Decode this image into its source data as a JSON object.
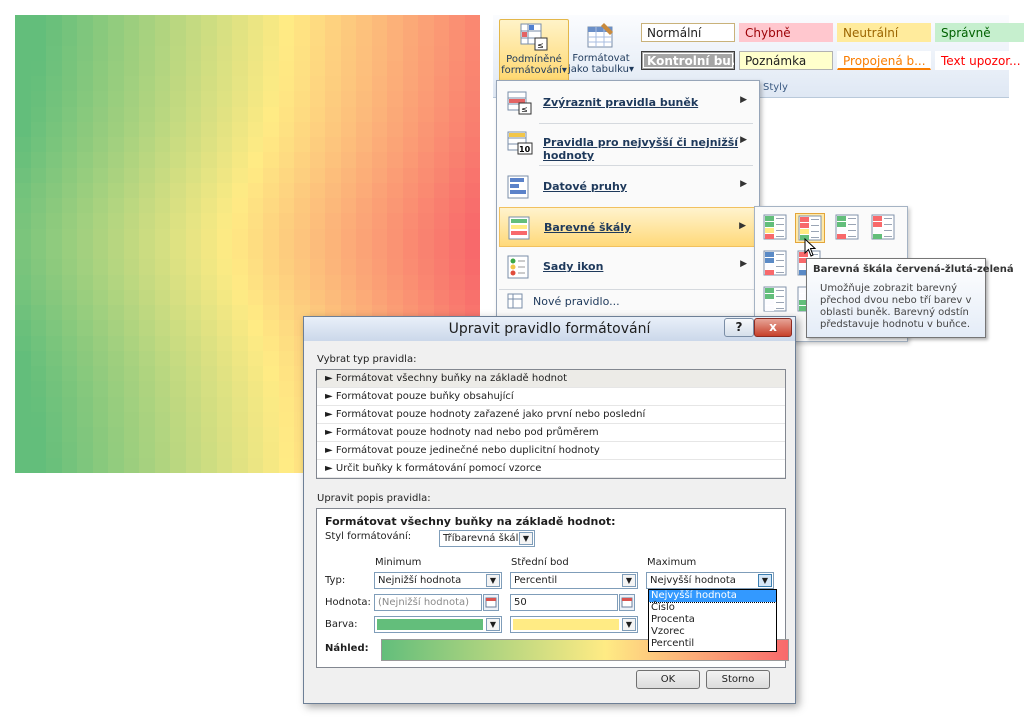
{
  "ribbon": {
    "cond_format": {
      "line1": "Podmíněné",
      "line2": "formátování",
      "arrow": "▾"
    },
    "format_table": {
      "line1": "Formátovat",
      "line2": "jako tabulku",
      "arrow": "▾"
    },
    "styles": [
      {
        "label": "Normální",
        "bg": "#ffffff",
        "fg": "#1e1e1e",
        "border": "#c9b27a"
      },
      {
        "label": "Chybně",
        "bg": "#ffc7ce",
        "fg": "#9c0006",
        "border": "#ffc7ce"
      },
      {
        "label": "Neutrální",
        "bg": "#ffeb9c",
        "fg": "#9c6500",
        "border": "#ffeb9c"
      },
      {
        "label": "Správně",
        "bg": "#c6efce",
        "fg": "#006100",
        "border": "#c6efce"
      },
      {
        "label": "Kontrolní bu...",
        "bg": "#a5a5a5",
        "fg": "#ffffff",
        "border": "#3f3f3f"
      },
      {
        "label": "Poznámka",
        "bg": "#ffffcc",
        "fg": "#1e1e1e",
        "border": "#b2b2b2"
      },
      {
        "label": "Propojená b...",
        "bg": "#ffffff",
        "fg": "#fa7d00",
        "border": "#ffffff"
      },
      {
        "label": "Text upozor...",
        "bg": "#ffffff",
        "fg": "#ff0000",
        "border": "#ffffff"
      }
    ],
    "group_label": "Styly"
  },
  "menu": {
    "items": [
      {
        "label": "Zvýraznit pravidla buněk",
        "icon": "highlight-rules-icon"
      },
      {
        "label": "Pravidla pro nejvyšší či nejnižší hodnoty",
        "icon": "top-bottom-icon"
      },
      {
        "label": "Datové pruhy",
        "icon": "data-bars-icon"
      },
      {
        "label": "Barevné škály",
        "icon": "color-scales-icon"
      },
      {
        "label": "Sady ikon",
        "icon": "icon-sets-icon"
      }
    ],
    "new_rule": "Nové pravidlo...",
    "arrow": "▶"
  },
  "tooltip": {
    "title": "Barevná škála červená-žlutá-zelená",
    "body": "Umožňuje zobrazit barevný přechod dvou nebo tří barev v oblasti buněk. Barevný odstín představuje hodnotu v buňce."
  },
  "dialog": {
    "title": "Upravit pravidlo formátování",
    "help": "?",
    "close": "x",
    "select_type_label": "Vybrat typ pravidla:",
    "rule_types": [
      "► Formátovat všechny buňky na základě hodnot",
      "► Formátovat pouze buňky obsahující",
      "► Formátovat pouze hodnoty zařazené jako první nebo poslední",
      "► Formátovat pouze hodnoty nad nebo pod průměrem",
      "► Formátovat pouze jedinečné nebo duplicitní hodnoty",
      "► Určit buňky k formátování pomocí vzorce"
    ],
    "edit_desc_label": "Upravit popis pravidla:",
    "desc_heading": "Formátovat všechny buňky na základě hodnot:",
    "style_label": "Styl formátování:",
    "style_value": "Tříbarevná škála",
    "col_min": "Minimum",
    "col_mid": "Střední bod",
    "col_max": "Maximum",
    "type_label": "Typ:",
    "value_label": "Hodnota:",
    "color_label": "Barva:",
    "min_type": "Nejnižší hodnota",
    "mid_type": "Percentil",
    "max_type": "Nejvyšší hodnota",
    "min_value": "(Nejnižší hodnota)",
    "mid_value": "50",
    "min_color": "#63be7b",
    "mid_color": "#ffeb84",
    "max_color": "#f8696b",
    "dropdown_options": [
      "Nejvyšší hodnota",
      "Číslo",
      "Procenta",
      "Vzorec",
      "Percentil"
    ],
    "preview_label": "Náhled:",
    "ok": "OK",
    "cancel": "Storno"
  }
}
